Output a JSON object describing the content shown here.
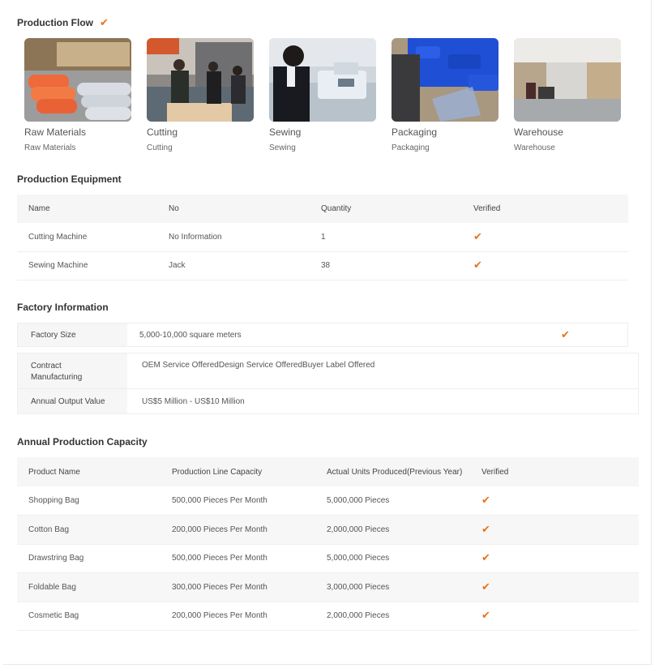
{
  "production_flow": {
    "title": "Production Flow",
    "verified_icon": "check-icon",
    "accent_color": "#e5731f",
    "steps": [
      {
        "label": "Raw Materials",
        "sub": "Raw Materials"
      },
      {
        "label": "Cutting",
        "sub": "Cutting"
      },
      {
        "label": "Sewing",
        "sub": "Sewing"
      },
      {
        "label": "Packaging",
        "sub": "Packaging"
      },
      {
        "label": "Warehouse",
        "sub": "Warehouse"
      }
    ]
  },
  "equipment": {
    "title": "Production Equipment",
    "headers": {
      "name": "Name",
      "no": "No",
      "quantity": "Quantity",
      "verified": "Verified"
    },
    "rows": [
      {
        "name": "Cutting Machine",
        "no": "No Information",
        "quantity": "1",
        "verified": "✔"
      },
      {
        "name": "Sewing Machine",
        "no": "Jack",
        "quantity": "38",
        "verified": "✔"
      }
    ]
  },
  "factory_info": {
    "title": "Factory Information",
    "size": {
      "label": "Factory Size",
      "value": "5,000-10,000 square meters",
      "verified": "✔"
    },
    "contract": {
      "label": "Contract Manufacturing",
      "value": "OEM Service OfferedDesign Service OfferedBuyer Label Offered"
    },
    "output": {
      "label": "Annual Output Value",
      "value": "US$5 Million - US$10 Million"
    }
  },
  "capacity": {
    "title": "Annual Production Capacity",
    "headers": {
      "product": "Product Name",
      "line": "Production Line Capacity",
      "actual": "Actual Units Produced(Previous Year)",
      "verified": "Verified"
    },
    "rows": [
      {
        "product": "Shopping Bag",
        "line": "500,000 Pieces Per Month",
        "actual": "5,000,000 Pieces",
        "verified": "✔"
      },
      {
        "product": "Cotton Bag",
        "line": "200,000 Pieces Per Month",
        "actual": "2,000,000 Pieces",
        "verified": "✔"
      },
      {
        "product": "Drawstring Bag",
        "line": "500,000 Pieces Per Month",
        "actual": "5,000,000 Pieces",
        "verified": "✔"
      },
      {
        "product": "Foldable Bag",
        "line": "300,000 Pieces Per Month",
        "actual": "3,000,000 Pieces",
        "verified": "✔"
      },
      {
        "product": "Cosmetic Bag",
        "line": "200,000 Pieces Per Month",
        "actual": "2,000,000 Pieces",
        "verified": "✔"
      }
    ]
  }
}
